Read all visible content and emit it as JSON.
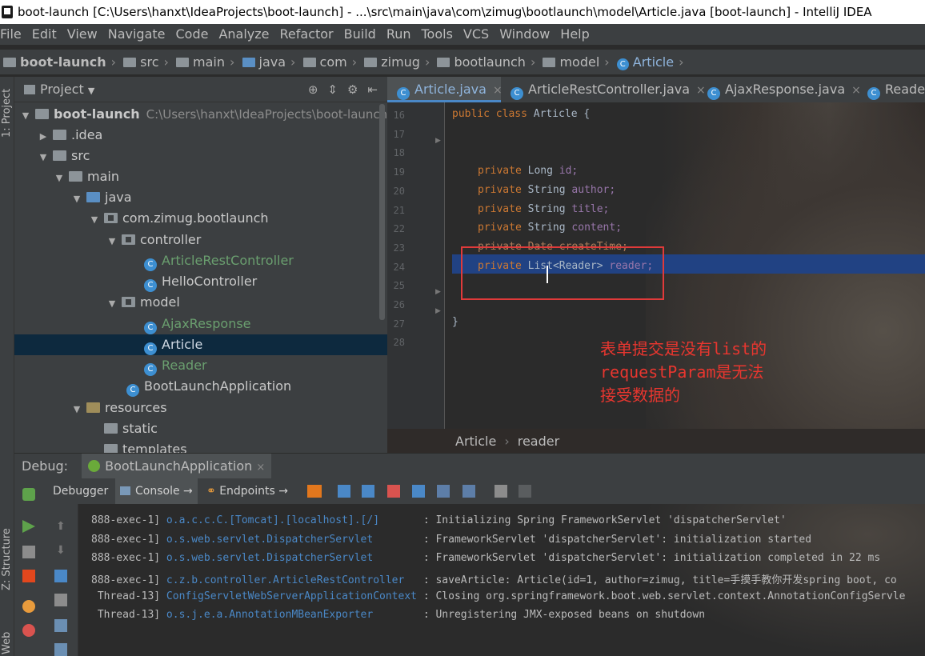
{
  "window": {
    "title": "boot-launch [C:\\Users\\hanxt\\IdeaProjects\\boot-launch] - ...\\src\\main\\java\\com\\zimug\\bootlaunch\\model\\Article.java [boot-launch] - IntelliJ IDEA"
  },
  "menu": [
    "File",
    "Edit",
    "View",
    "Navigate",
    "Code",
    "Analyze",
    "Refactor",
    "Build",
    "Run",
    "Tools",
    "VCS",
    "Window",
    "Help"
  ],
  "breadcrumbs": [
    "boot-launch",
    "src",
    "main",
    "java",
    "com",
    "zimug",
    "bootlaunch",
    "model",
    "Article"
  ],
  "left_strip": {
    "project": "1: Project",
    "structure": "Z: Structure",
    "web": "Web"
  },
  "project": {
    "header": "Project",
    "tree": [
      {
        "label": "boot-launch",
        "path": "C:\\Users\\hanxt\\IdeaProjects\\boot-launch"
      },
      {
        "label": ".idea"
      },
      {
        "label": "src"
      },
      {
        "label": "main"
      },
      {
        "label": "java"
      },
      {
        "label": "com.zimug.bootlaunch"
      },
      {
        "label": "controller"
      },
      {
        "label": "ArticleRestController"
      },
      {
        "label": "HelloController"
      },
      {
        "label": "model"
      },
      {
        "label": "AjaxResponse"
      },
      {
        "label": "Article"
      },
      {
        "label": "Reader"
      },
      {
        "label": "BootLaunchApplication"
      },
      {
        "label": "resources"
      },
      {
        "label": "static"
      },
      {
        "label": "templates"
      }
    ]
  },
  "editor": {
    "tabs": [
      "Article.java",
      "ArticleRestController.java",
      "AjaxResponse.java",
      "Reader"
    ],
    "line_numbers": [
      "16",
      "17",
      "18",
      "19",
      "20",
      "21",
      "22",
      "23",
      "24",
      "25",
      "26",
      "27",
      "28"
    ],
    "code": {
      "l16_kw": "public class",
      "l16_rest": " Article {",
      "priv": "private",
      "long": "Long",
      "string": "String",
      "date": "Date",
      "list": "List",
      "reader_type": "<Reader>",
      "f_id": "id;",
      "f_author": "author;",
      "f_title": "title;",
      "f_content": "content;",
      "f_createTime": "createTime;",
      "f_reader": "reader;",
      "close": "}"
    },
    "annotation": [
      "表单提交是没有list的",
      "requestParam是无法",
      "接受数据的"
    ],
    "breadcrumb": [
      "Article",
      "reader"
    ]
  },
  "debug": {
    "label": "Debug:",
    "app_tab": "BootLaunchApplication",
    "tabs": [
      "Debugger",
      "Console",
      "Endpoints"
    ],
    "log": [
      {
        "thread": "888-exec-1]",
        "logger": "o.a.c.c.C.[Tomcat].[localhost].[/]",
        "msg": ": Initializing Spring FrameworkServlet 'dispatcherServlet'"
      },
      {
        "thread": "888-exec-1]",
        "logger": "o.s.web.servlet.DispatcherServlet",
        "msg": ": FrameworkServlet 'dispatcherServlet': initialization started"
      },
      {
        "thread": "888-exec-1]",
        "logger": "o.s.web.servlet.DispatcherServlet",
        "msg": ": FrameworkServlet 'dispatcherServlet': initialization completed in 22 ms"
      },
      {
        "thread": "888-exec-1]",
        "logger": "c.z.b.controller.ArticleRestController",
        "msg": ": saveArticle: Article(id=1, author=zimug, title=手摸手教你开发spring boot, co"
      },
      {
        "thread": " Thread-13]",
        "logger": "ConfigServletWebServerApplicationContext",
        "msg": ": Closing org.springframework.boot.web.servlet.context.AnnotationConfigServle"
      },
      {
        "thread": " Thread-13]",
        "logger": "o.s.j.e.a.AnnotationMBeanExporter",
        "msg": ": Unregistering JMX-exposed beans on shutdown"
      }
    ]
  }
}
